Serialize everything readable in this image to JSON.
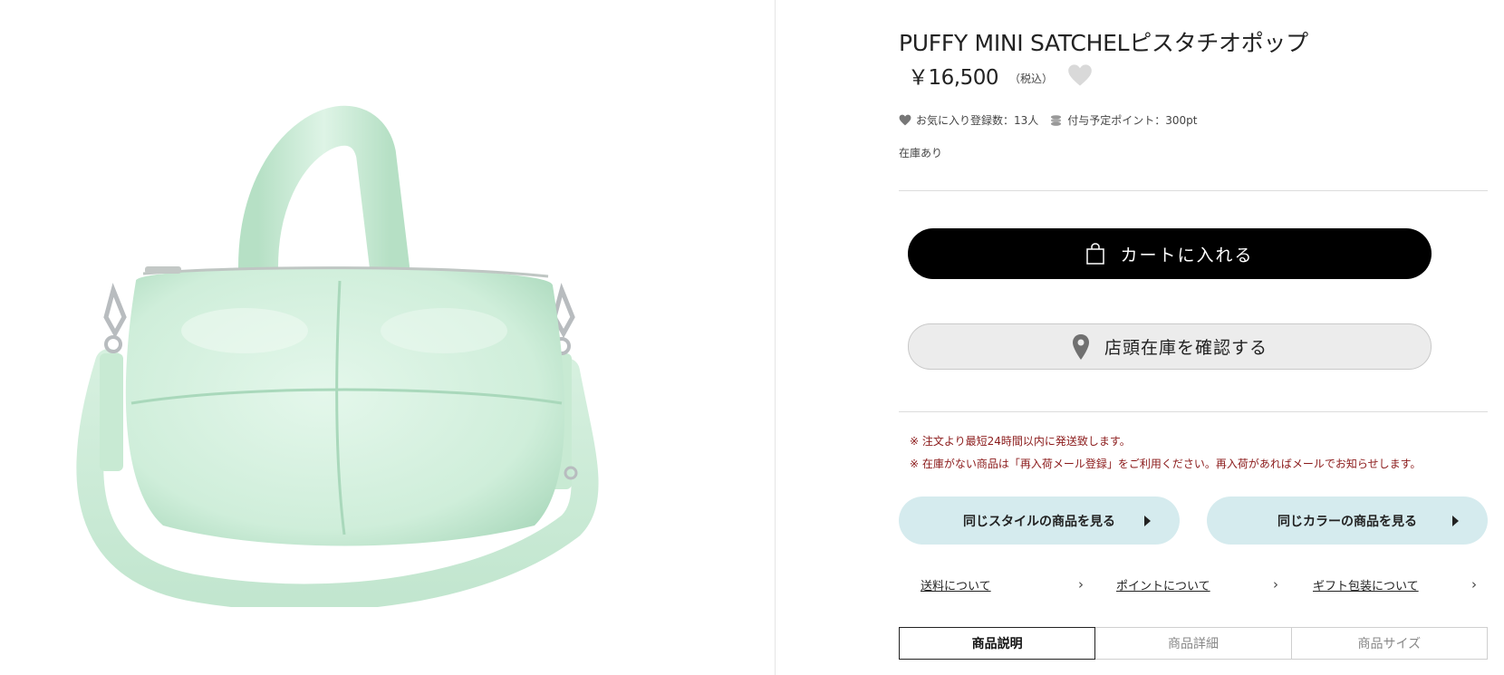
{
  "product": {
    "title": "PUFFY MINI SATCHELピスタチオポップ",
    "price": "￥16,500",
    "tax_label": "（税込）",
    "favorites_text": "お気に入り登録数：13人",
    "points_text": "付与予定ポイント：300pt",
    "stock_status": "在庫あり",
    "image_colors": {
      "bag": "#cfeeda",
      "bag_shade": "#a9d8bb",
      "bag_light": "#e4f7eb",
      "hardware": "#b8bcbf"
    }
  },
  "actions": {
    "cart_label": "カートに入れる",
    "store_stock_label": "店頭在庫を確認する"
  },
  "notices": [
    "※ 注文より最短24時間以内に発送致します。",
    "※ 在庫がない商品は「再入荷メール登録」をご利用ください。再入荷があればメールでお知らせします。"
  ],
  "related": {
    "same_style": "同じスタイルの商品を見る",
    "same_color": "同じカラーの商品を見る"
  },
  "info_links": [
    {
      "label": "送料について"
    },
    {
      "label": "ポイントについて"
    },
    {
      "label": "ギフト包装について"
    }
  ],
  "tabs": [
    {
      "label": "商品説明",
      "active": true
    },
    {
      "label": "商品詳細",
      "active": false
    },
    {
      "label": "商品サイズ",
      "active": false
    }
  ],
  "colors": {
    "notice_text": "#8b1a1a",
    "cart_button_bg": "#000000",
    "related_button_bg": "#d5ebee",
    "favorite_heart": "#d9d9d9"
  }
}
